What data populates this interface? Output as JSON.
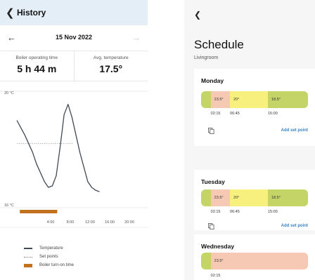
{
  "history": {
    "back_icon": "chevron-left-icon",
    "title": "History",
    "date": "15 Nov 2022",
    "prev_icon": "arrow-left-icon",
    "next_icon": "arrow-right-icon",
    "stats": [
      {
        "label": "Boiler operating time",
        "value": "5 h 44 m"
      },
      {
        "label": "Avg. temperature",
        "value": "17.5°"
      }
    ],
    "legend": [
      {
        "label": "Temperature"
      },
      {
        "label": "Set points"
      },
      {
        "label": "Boiler turn-on time"
      }
    ]
  },
  "chart_data": {
    "type": "line",
    "x_unit": "hour",
    "xlim": [
      0,
      24
    ],
    "ylim": [
      16,
      20
    ],
    "y_tick_labels": [
      "20 °C",
      "16 °C"
    ],
    "x_tick_labels": [
      "4:00",
      "8:00",
      "12:00",
      "16:00",
      "20:00"
    ],
    "x_ticks": [
      4,
      8,
      12,
      16,
      20
    ],
    "series": [
      {
        "name": "Temperature",
        "color": "#3e4a55",
        "x": [
          0.0,
          0.8,
          1.6,
          2.4,
          3.2,
          4.0,
          4.8,
          5.6,
          6.4,
          7.2,
          8.0,
          8.8,
          9.6,
          10.4,
          11.2,
          12.0,
          12.8,
          13.6,
          14.4,
          15.2,
          16.0,
          16.8
        ],
        "y": [
          19.0,
          18.75,
          18.5,
          18.2,
          17.9,
          17.5,
          17.2,
          16.9,
          16.7,
          16.75,
          17.1,
          18.1,
          19.2,
          19.55,
          19.1,
          18.5,
          17.9,
          17.4,
          16.9,
          16.7,
          16.6,
          16.55
        ]
      },
      {
        "name": "Set points",
        "color": "#8a8a8a",
        "x": [
          0,
          13.6
        ],
        "y": [
          18.2,
          18.2
        ]
      }
    ],
    "bars": [
      {
        "name": "Boiler turn-on time",
        "color": "#c2711d",
        "start": 0.6,
        "end": 8.2
      }
    ]
  },
  "schedule": {
    "back_icon": "chevron-left-icon",
    "title": "Schedule",
    "subtitle": "Livingroom",
    "add_label": "Add set point",
    "days": [
      {
        "name": "Monday",
        "segments": [
          {
            "temp": "",
            "color": "#c4d466",
            "start": 0.0,
            "end": 0.09
          },
          {
            "temp": "23.5°",
            "color": "#f6c9b4",
            "start": 0.09,
            "end": 0.27
          },
          {
            "temp": "20°",
            "color": "#f7f07e",
            "start": 0.27,
            "end": 0.625
          },
          {
            "temp": "18.5°",
            "color": "#c4d466",
            "start": 0.625,
            "end": 1.0
          }
        ],
        "times": [
          "02:15",
          "06:45",
          "15:00"
        ]
      },
      {
        "name": "Tuesday",
        "segments": [
          {
            "temp": "",
            "color": "#c4d466",
            "start": 0.0,
            "end": 0.09
          },
          {
            "temp": "23.5°",
            "color": "#f6c9b4",
            "start": 0.09,
            "end": 0.27
          },
          {
            "temp": "20°",
            "color": "#f7f07e",
            "start": 0.27,
            "end": 0.625
          },
          {
            "temp": "18.5°",
            "color": "#c4d466",
            "start": 0.625,
            "end": 1.0
          }
        ],
        "times": [
          "02:15",
          "06:45",
          "15:00"
        ]
      },
      {
        "name": "Wednesday",
        "segments": [
          {
            "temp": "",
            "color": "#c4d466",
            "start": 0.0,
            "end": 0.09
          },
          {
            "temp": "23.5°",
            "color": "#f6c9b4",
            "start": 0.09,
            "end": 1.0
          }
        ],
        "times": [
          "02:15"
        ]
      }
    ]
  }
}
